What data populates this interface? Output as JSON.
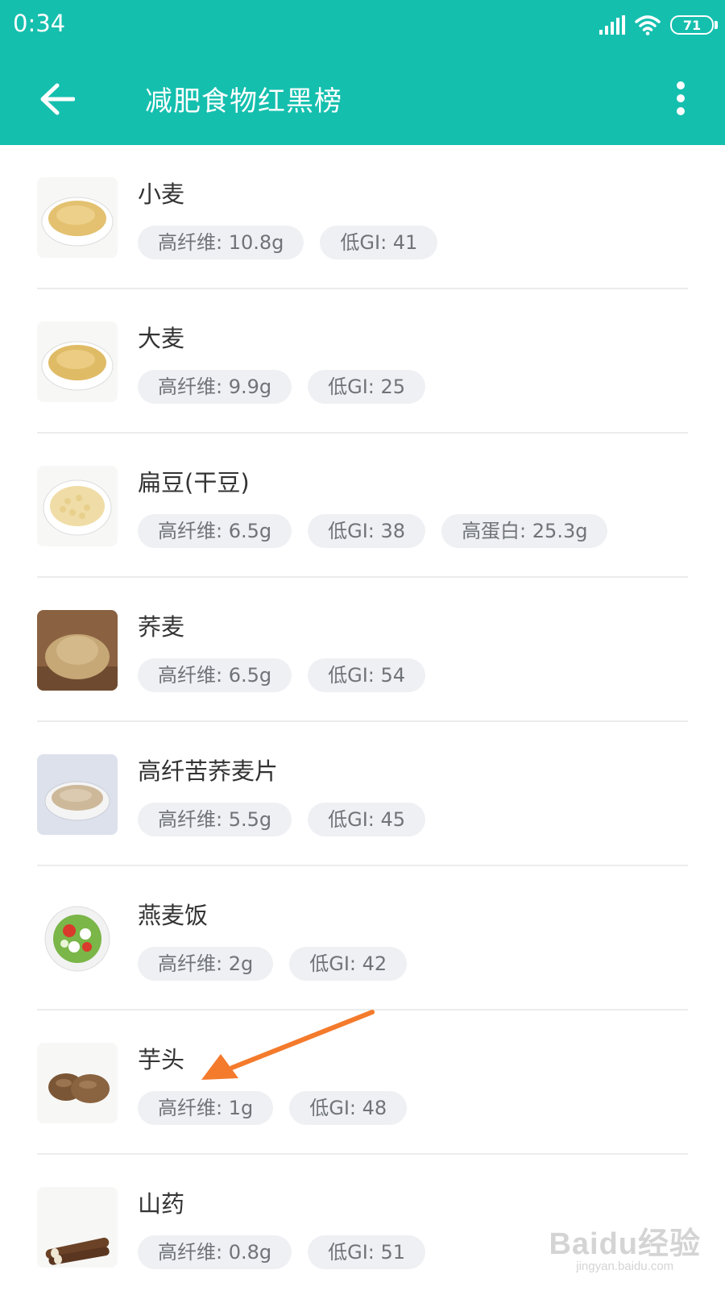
{
  "status": {
    "time": "0:34",
    "battery": "71"
  },
  "toolbar": {
    "title": "减肥食物红黑榜",
    "back_icon": "arrow-left-icon",
    "more_icon": "more-vert-icon"
  },
  "foods": [
    {
      "name": "小麦",
      "tags": [
        "高纤维: 10.8g",
        "低GI: 41"
      ]
    },
    {
      "name": "大麦",
      "tags": [
        "高纤维: 9.9g",
        "低GI: 25"
      ]
    },
    {
      "name": "扁豆(干豆)",
      "tags": [
        "高纤维: 6.5g",
        "低GI: 38",
        "高蛋白: 25.3g"
      ]
    },
    {
      "name": "荞麦",
      "tags": [
        "高纤维: 6.5g",
        "低GI: 54"
      ]
    },
    {
      "name": "高纤苦荞麦片",
      "tags": [
        "高纤维: 5.5g",
        "低GI: 45"
      ]
    },
    {
      "name": "燕麦饭",
      "tags": [
        "高纤维: 2g",
        "低GI: 42"
      ]
    },
    {
      "name": "芋头",
      "tags": [
        "高纤维: 1g",
        "低GI: 48"
      ]
    },
    {
      "name": "山药",
      "tags": [
        "高纤维: 0.8g",
        "低GI: 51"
      ]
    }
  ],
  "watermark": {
    "logo": "Baidu经验",
    "url": "jingyan.baidu.com"
  },
  "colors": {
    "primary": "#15bfae",
    "arrow": "#f47a2c",
    "tag_bg": "#eef0f3"
  }
}
